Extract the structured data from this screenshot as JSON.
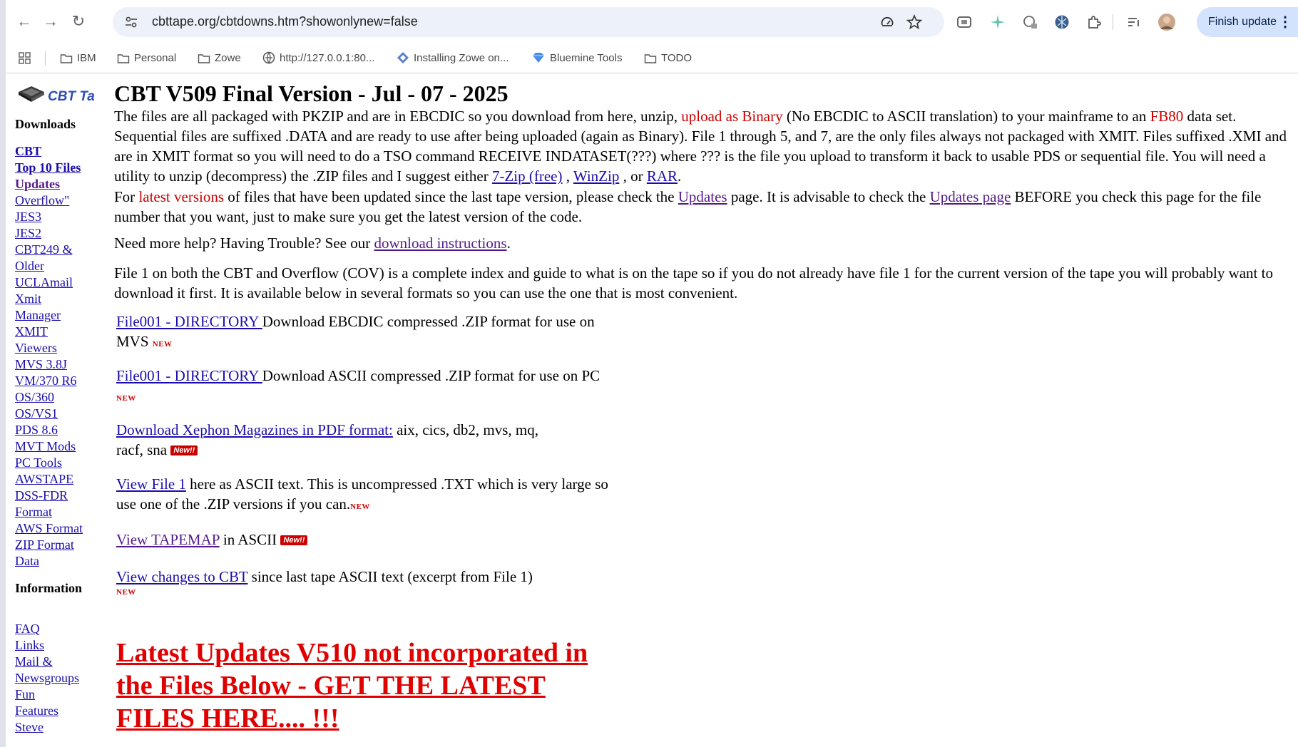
{
  "browser": {
    "url": "cbttape.org/cbtdowns.htm?showonlynew=false",
    "finish_update": "Finish update",
    "bookmarks": [
      "IBM",
      "Personal",
      "Zowe",
      "http://127.0.0.1:80...",
      "Installing Zowe on...",
      "Bluemine Tools",
      "TODO"
    ]
  },
  "logo": {
    "text": "CBT Tape"
  },
  "sidebar": {
    "downloads_heading": "Downloads",
    "downloads": [
      "CBT",
      "Top 10 Files",
      "Updates",
      "Overflow\"",
      "JES3",
      "JES2",
      "CBT249 &",
      "Older",
      "UCLAmail",
      "Xmit",
      "Manager",
      "XMIT",
      "Viewers",
      "MVS 3.8J",
      "VM/370 R6",
      "OS/360",
      "OS/VS1",
      "PDS 8.6",
      "MVT Mods",
      "PC Tools",
      "AWSTAPE",
      "DSS-FDR",
      "Format",
      "AWS Format",
      "ZIP Format",
      "Data"
    ],
    "information_heading": "Information",
    "information": [
      "FAQ",
      "Links",
      "Mail &",
      "Newsgroups",
      "Fun",
      "Features",
      "Steve"
    ]
  },
  "main": {
    "title": "CBT V509 Final Version  -  Jul - 07 - 2025",
    "p1": {
      "a": "The files are all packaged with PKZIP and are in EBCDIC so you download from here, unzip, ",
      "red1": "upload as Binary",
      "b": " (No EBCDIC to ASCII translation) to your mainframe to an ",
      "red2": "FB80",
      "c": " data set.  Sequential files are suffixed .DATA and are ready to use after being uploaded (again as Binary). File 1 through 5, and 7, are the only files always not packaged with XMIT.  Files suffixed .XMI and are in XMIT format so you will need to do a TSO command RECEIVE INDATASET(???) where ??? is the file you upload to transform it back to usable PDS or sequential file.  You will need a utility to unzip (decompress) the .ZIP files and I suggest either ",
      "link1": "7-Zip (free)",
      "d": " , ",
      "link2": "WinZip",
      "e": " , or ",
      "link3": "RAR",
      "f": "."
    },
    "p2": {
      "a": "For ",
      "red": "latest versions",
      "b": " of files that have been updated since the last tape version, please check the ",
      "link1": "Updates",
      "c": " page. It is advisable to check the ",
      "link2": "Updates page",
      "d": " BEFORE you check this page for the file number that you want, just to make sure you get the latest version of the code."
    },
    "p3": {
      "a": "Need more help?  Having Trouble? See our ",
      "link": "download instructions",
      "b": "."
    },
    "p4": "File 1 on both the CBT and Overflow (COV) is a complete index and guide to what is on the tape so if you do not already have file 1 for the current version of the tape you will probably want to download it first.  It is available below in several formats so you can use the one that is most convenient.",
    "items": [
      {
        "link": "File001 - DIRECTORY ",
        "text": " Download EBCDIC compressed .ZIP format for use on MVS ",
        "badge": "NEW"
      },
      {
        "link": "File001 - DIRECTORY ",
        "text": " Download ASCII compressed .ZIP format for use on PC  ",
        "badge": "NEW"
      },
      {
        "link": "Download Xephon Magazines in PDF format:",
        "text": " aix, cics, db2, mvs, mq, racf, sna ",
        "badge": "New!!"
      },
      {
        "link": "View File 1",
        "text": " here as ASCII text. This is uncompressed .TXT which is very large so use one of the .ZIP versions if you can.",
        "badge": "NEW"
      },
      {
        "link": "View TAPEMAP",
        "text": " in ASCII ",
        "badge": "New!!"
      },
      {
        "link": "View changes to CBT",
        "text": " since last tape ASCII text (excerpt from File 1)",
        "badge": "NEW"
      }
    ],
    "big_red": "Latest Updates V510 not incorporated in the Files Below - GET THE LATEST FILES HERE.... !!!"
  }
}
